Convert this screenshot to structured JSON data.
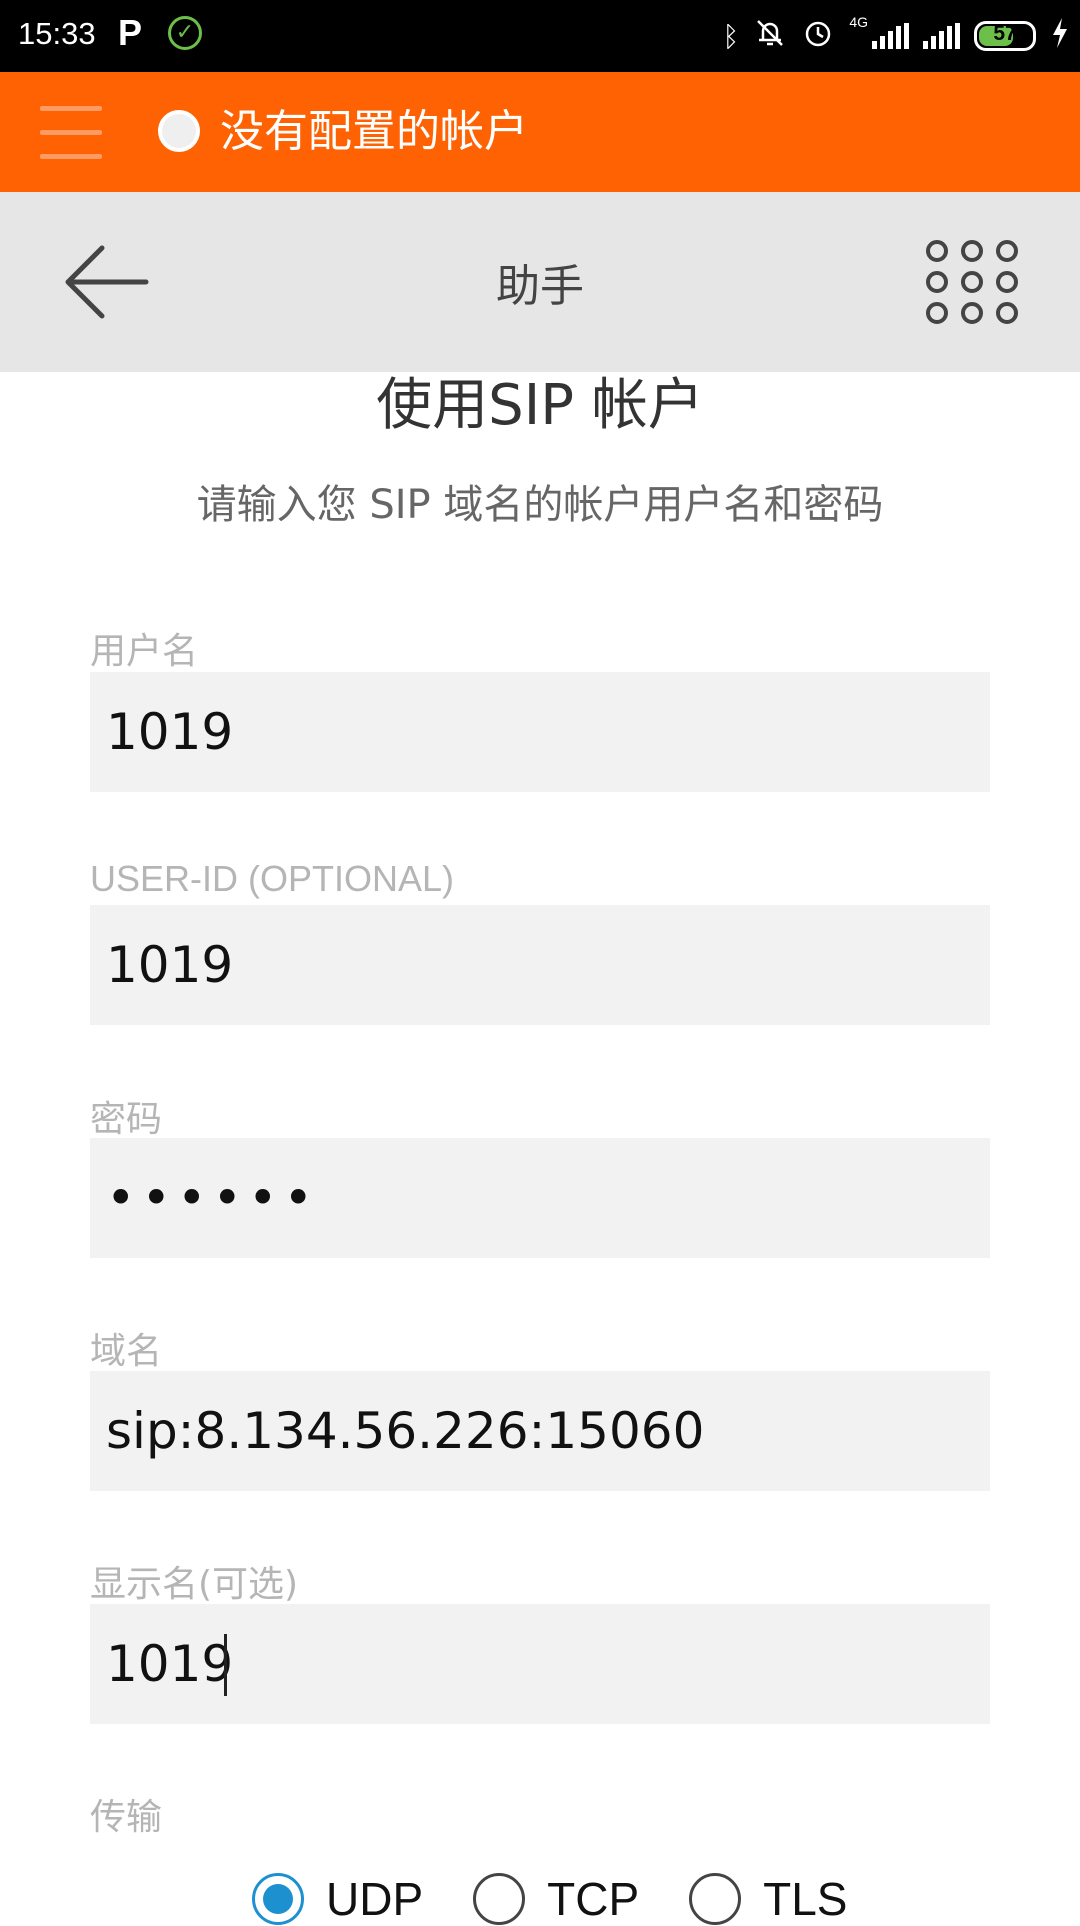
{
  "status_bar": {
    "time": "15:33",
    "p_icon": "P",
    "network": "4G",
    "battery": "57"
  },
  "account_bar": {
    "title": "没有配置的帐户"
  },
  "header": {
    "title": "助手"
  },
  "content": {
    "title": "使用SIP 帐户",
    "subtitle": "请输入您 SIP 域名的帐户用户名和密码"
  },
  "fields": {
    "username": {
      "label": "用户名",
      "value": "1019"
    },
    "userid": {
      "label": "USER-ID (OPTIONAL)",
      "value": "1019"
    },
    "password": {
      "label": "密码",
      "value": "••••••"
    },
    "domain": {
      "label": "域名",
      "value": "sip:8.134.56.226:15060"
    },
    "display_name": {
      "label": "显示名(可选)",
      "value": "1019"
    }
  },
  "transport": {
    "label": "传输",
    "options": [
      "UDP",
      "TCP",
      "TLS"
    ],
    "selected": "UDP"
  },
  "colors": {
    "accent": "#ff6203",
    "radio_selected": "#1d91d0"
  }
}
